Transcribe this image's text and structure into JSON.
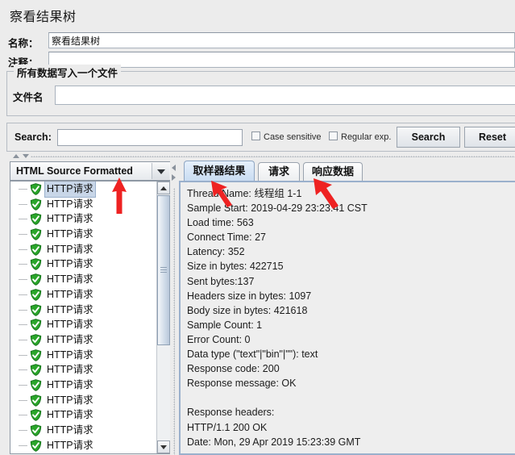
{
  "window": {
    "title": "察看结果树"
  },
  "form": {
    "name_label": "名称：",
    "name_value": "察看结果树",
    "comment_label": "注释：",
    "comment_value": ""
  },
  "file_group": {
    "title": "所有数据写入一个文件",
    "filename_label": "文件名",
    "filename_value": ""
  },
  "search_bar": {
    "label": "Search:",
    "query_value": "",
    "case_sensitive_label": "Case sensitive",
    "case_sensitive_checked": false,
    "regular_exp_label": "Regular exp.",
    "regular_exp_checked": false,
    "search_button": "Search",
    "reset_button": "Reset"
  },
  "left_pane": {
    "renderer_selected": "HTML Source Formatted",
    "tree_items": [
      {
        "label": "HTTP请求",
        "status": "success",
        "selected": true
      },
      {
        "label": "HTTP请求",
        "status": "success",
        "selected": false
      },
      {
        "label": "HTTP请求",
        "status": "success",
        "selected": false
      },
      {
        "label": "HTTP请求",
        "status": "success",
        "selected": false
      },
      {
        "label": "HTTP请求",
        "status": "success",
        "selected": false
      },
      {
        "label": "HTTP请求",
        "status": "success",
        "selected": false
      },
      {
        "label": "HTTP请求",
        "status": "success",
        "selected": false
      },
      {
        "label": "HTTP请求",
        "status": "success",
        "selected": false
      },
      {
        "label": "HTTP请求",
        "status": "success",
        "selected": false
      },
      {
        "label": "HTTP请求",
        "status": "success",
        "selected": false
      },
      {
        "label": "HTTP请求",
        "status": "success",
        "selected": false
      },
      {
        "label": "HTTP请求",
        "status": "success",
        "selected": false
      },
      {
        "label": "HTTP请求",
        "status": "success",
        "selected": false
      },
      {
        "label": "HTTP请求",
        "status": "success",
        "selected": false
      },
      {
        "label": "HTTP请求",
        "status": "success",
        "selected": false
      },
      {
        "label": "HTTP请求",
        "status": "success",
        "selected": false
      },
      {
        "label": "HTTP请求",
        "status": "success",
        "selected": false
      },
      {
        "label": "HTTP请求",
        "status": "success",
        "selected": false
      }
    ]
  },
  "right_pane": {
    "tabs": [
      {
        "label": "取样器结果",
        "active": true
      },
      {
        "label": "请求",
        "active": false
      },
      {
        "label": "响应数据",
        "active": false
      }
    ],
    "sampler_result": "Thread Name: 线程组 1-1\nSample Start: 2019-04-29 23:23:41 CST\nLoad time: 563\nConnect Time: 27\nLatency: 352\nSize in bytes: 422715\nSent bytes:137\nHeaders size in bytes: 1097\nBody size in bytes: 421618\nSample Count: 1\nError Count: 0\nData type (\"text\"|\"bin\"|\"\"): text\nResponse code: 200\nResponse message: OK\n\nResponse headers:\nHTTP/1.1 200 OK\nDate: Mon, 29 Apr 2019 15:23:39 GMT"
  },
  "annotations": {
    "arrow_color": "#ee2222",
    "arrows": [
      {
        "name": "arrow-to-tree-item"
      },
      {
        "name": "arrow-to-sampler-result-tab"
      },
      {
        "name": "arrow-to-response-data-tab"
      }
    ]
  },
  "colors": {
    "panel_bg": "#ececec",
    "field_bg": "#ffffff",
    "active_tab": "#c9dcf2",
    "selection": "#c8d6e8",
    "success_icon": "#2aa52a",
    "border": "#9aa3ae"
  }
}
